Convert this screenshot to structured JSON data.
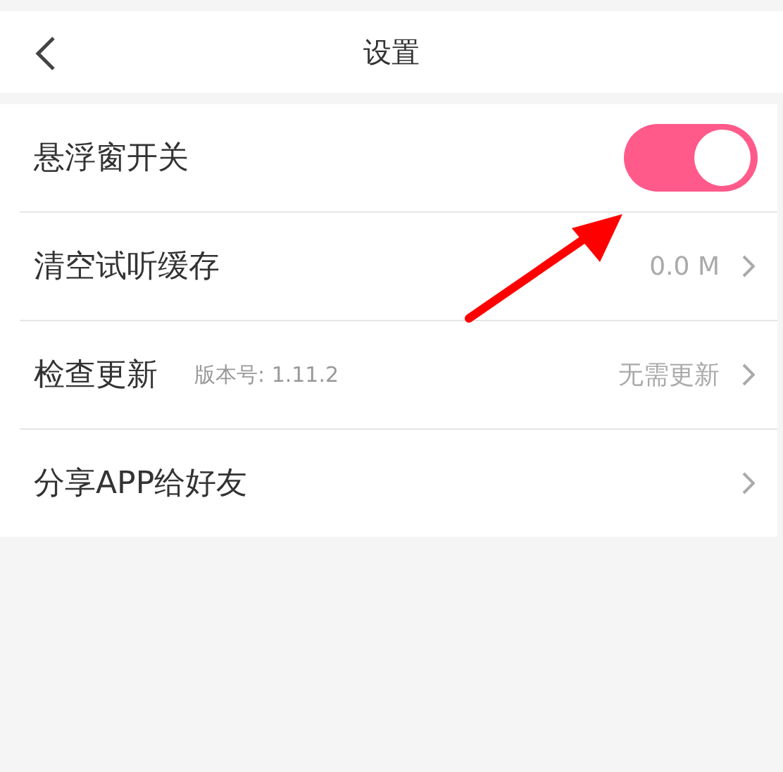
{
  "header": {
    "title": "设置"
  },
  "rows": [
    {
      "kind": "toggle",
      "label": "悬浮窗开关",
      "on": true
    },
    {
      "kind": "link",
      "label": "清空试听缓存",
      "value": "0.0 M"
    },
    {
      "kind": "link",
      "label": "检查更新",
      "note": "版本号: 1.11.2",
      "value": "无需更新"
    },
    {
      "kind": "link",
      "label": "分享APP给好友"
    }
  ]
}
